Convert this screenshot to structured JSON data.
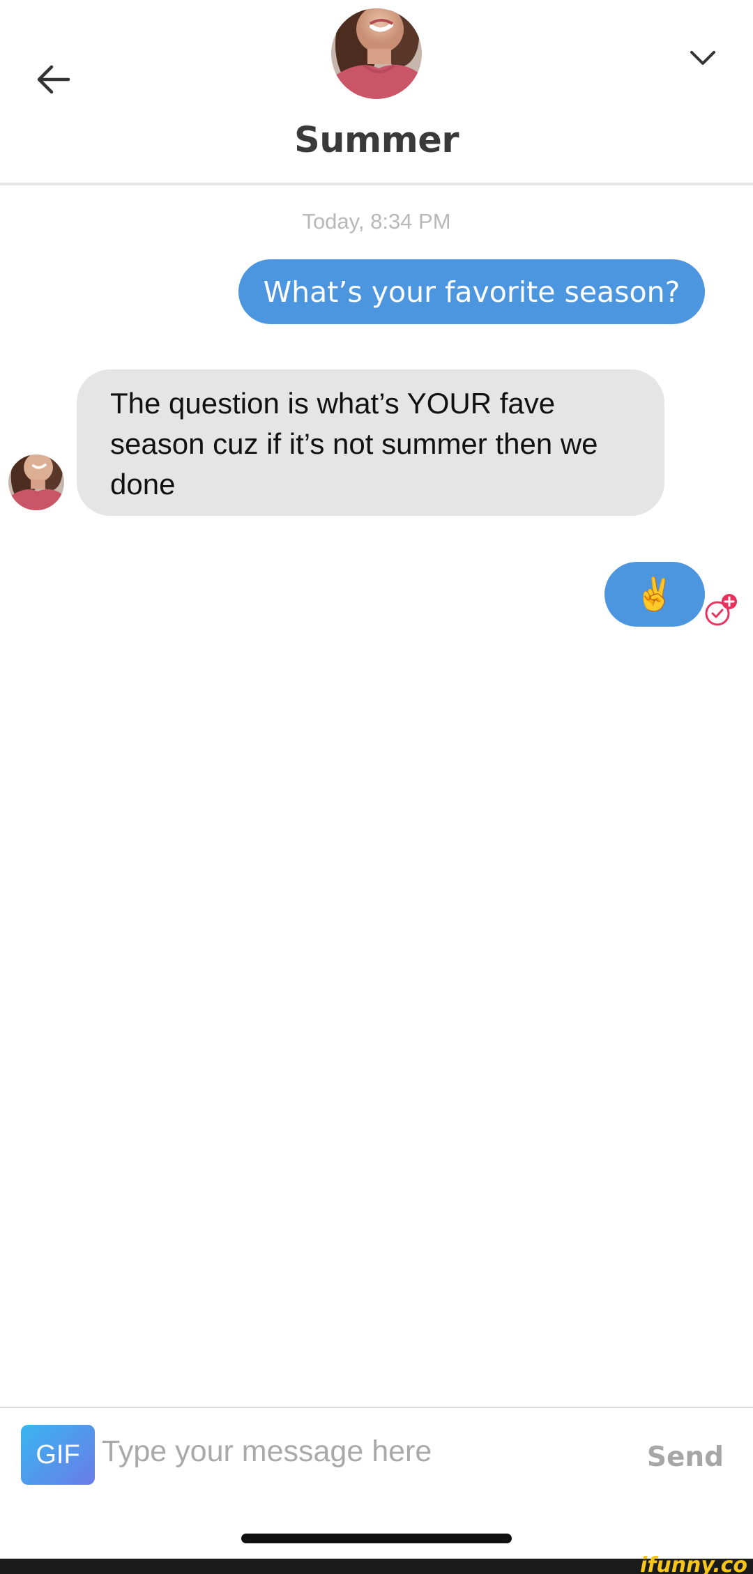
{
  "header": {
    "contact_name": "Summer"
  },
  "conversation": {
    "timestamp": "Today, 8:34 PM",
    "messages": [
      {
        "direction": "outgoing",
        "text": "What’s your favorite season?"
      },
      {
        "direction": "incoming",
        "text": "The question is what’s YOUR fave season cuz if it’s not summer then we done"
      },
      {
        "direction": "outgoing",
        "text": "✌️"
      }
    ]
  },
  "composer": {
    "gif_label": "GIF",
    "placeholder": "Type your message here",
    "send_label": "Send"
  },
  "watermark": {
    "text": "ifunny.co"
  },
  "colors": {
    "outgoing_bubble": "#4c95df",
    "incoming_bubble": "#e5e5e5",
    "react_accent": "#e8335f"
  }
}
